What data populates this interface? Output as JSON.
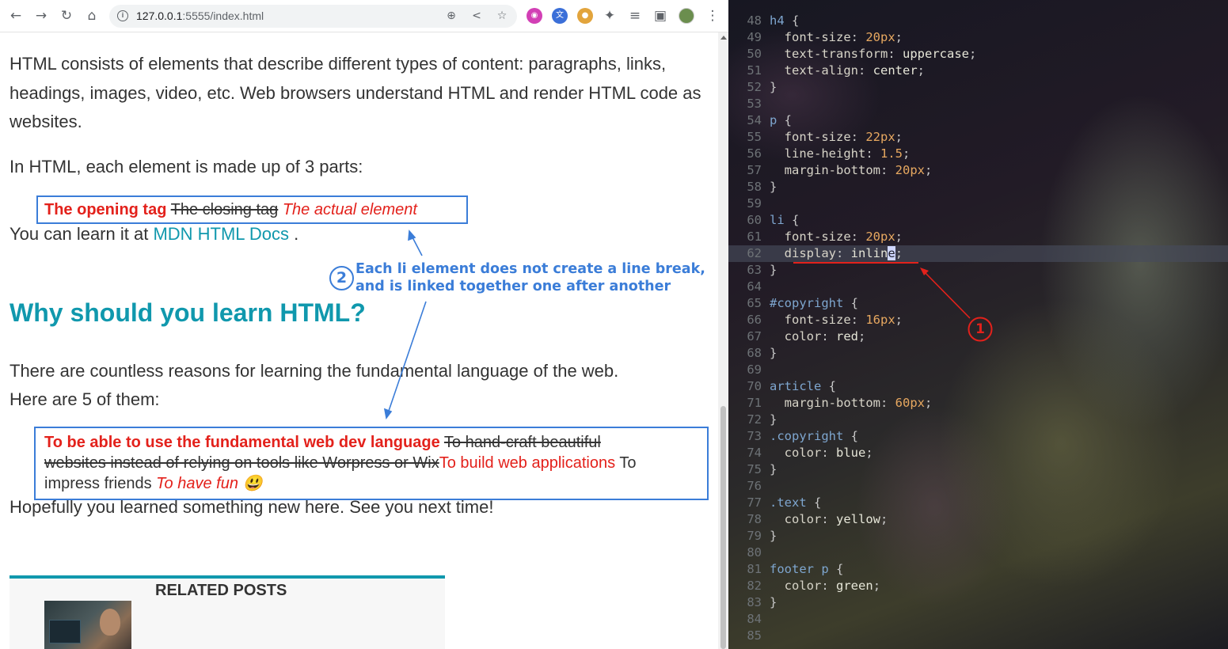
{
  "browser": {
    "url_host": "127.0.0.1",
    "url_rest": ":5555/index.html",
    "icons": [
      "back-icon",
      "forward-icon",
      "reload-icon",
      "home-icon",
      "info-icon",
      "zoom-icon",
      "share-icon",
      "star-icon",
      "extensions-icon",
      "media-icon",
      "sidepanel-icon",
      "avatar",
      "menu-icon"
    ]
  },
  "page": {
    "intro": "HTML consists of elements that describe different types of content: paragraphs, links, headings, images, video, etc. Web browsers understand HTML and render HTML code as websites.",
    "parts_intro": "In HTML, each element is made up of 3 parts:",
    "parts": {
      "item1": "The opening tag",
      "item2": "The closing tag",
      "item3": "The actual element"
    },
    "learn_prefix": "You can learn it at",
    "learn_link": "MDN HTML Docs",
    "learn_suffix": ".",
    "heading": "Why should you learn HTML?",
    "reasons_intro_1": "There are countless reasons for learning the fundamental language of the web.",
    "reasons_intro_2": "Here are 5 of them:",
    "reasons": {
      "r1": "To be able to use the fundamental web dev language",
      "r2a": "To hand-craft beautiful",
      "r2b": "websites instead of relying on tools like Worpress or Wix",
      "r3": "To build web applications",
      "r4a": "To",
      "r4b": "impress friends",
      "r5": "To have fun 😃"
    },
    "closing": "Hopefully you learned something new here. See you next time!",
    "related_title": "RELATED POSTS"
  },
  "annotations": {
    "note_number": "2",
    "note_line1": "Each li element does not create a line break,",
    "note_line2": "and is linked together one after another",
    "editor_number": "1",
    "blue": "#3b7dd8",
    "red": "#e3211b"
  },
  "editor": {
    "lines": [
      {
        "n": "48",
        "t": "h4 {"
      },
      {
        "n": "49",
        "t": "  font-size: 20px;"
      },
      {
        "n": "50",
        "t": "  text-transform: uppercase;"
      },
      {
        "n": "51",
        "t": "  text-align: center;"
      },
      {
        "n": "52",
        "t": "}"
      },
      {
        "n": "53",
        "t": ""
      },
      {
        "n": "54",
        "t": "p {"
      },
      {
        "n": "55",
        "t": "  font-size: 22px;"
      },
      {
        "n": "56",
        "t": "  line-height: 1.5;"
      },
      {
        "n": "57",
        "t": "  margin-bottom: 20px;"
      },
      {
        "n": "58",
        "t": "}"
      },
      {
        "n": "59",
        "t": ""
      },
      {
        "n": "60",
        "t": "li {"
      },
      {
        "n": "61",
        "t": "  font-size: 20px;"
      },
      {
        "n": "62",
        "t": "  display: inline;"
      },
      {
        "n": "63",
        "t": "}"
      },
      {
        "n": "64",
        "t": ""
      },
      {
        "n": "65",
        "t": "#copyright {"
      },
      {
        "n": "66",
        "t": "  font-size: 16px;"
      },
      {
        "n": "67",
        "t": "  color: red;"
      },
      {
        "n": "68",
        "t": "}"
      },
      {
        "n": "69",
        "t": ""
      },
      {
        "n": "70",
        "t": "article {"
      },
      {
        "n": "71",
        "t": "  margin-bottom: 60px;"
      },
      {
        "n": "72",
        "t": "}"
      },
      {
        "n": "73",
        "t": ".copyright {"
      },
      {
        "n": "74",
        "t": "  color: blue;"
      },
      {
        "n": "75",
        "t": "}"
      },
      {
        "n": "76",
        "t": ""
      },
      {
        "n": "77",
        "t": ".text {"
      },
      {
        "n": "78",
        "t": "  color: yellow;"
      },
      {
        "n": "79",
        "t": "}"
      },
      {
        "n": "80",
        "t": ""
      },
      {
        "n": "81",
        "t": "footer p {"
      },
      {
        "n": "82",
        "t": "  color: green;"
      },
      {
        "n": "83",
        "t": "}"
      },
      {
        "n": "84",
        "t": ""
      },
      {
        "n": "85",
        "t": ""
      }
    ],
    "active_line": "62"
  }
}
